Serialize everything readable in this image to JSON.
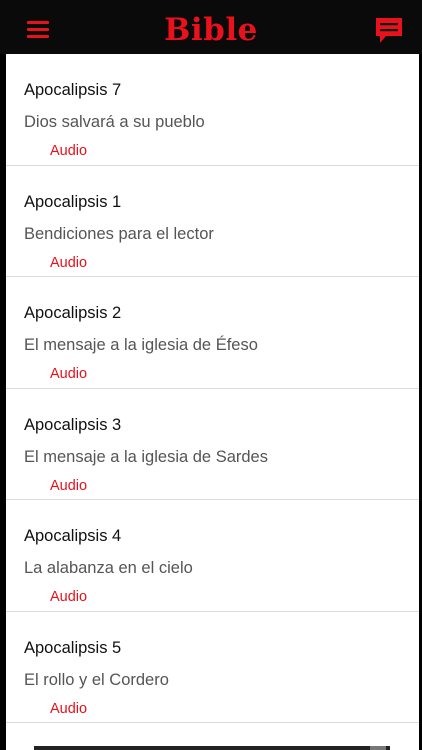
{
  "header": {
    "title": "Bible",
    "menu_icon": "hamburger-menu-icon",
    "chat_icon": "chat-bubble-icon",
    "accent_color": "#e8111c"
  },
  "items": [
    {
      "title": "Apocalipsis 7",
      "subtitle": "Dios salvará a su pueblo",
      "audio_label": "Audio"
    },
    {
      "title": "Apocalipsis 1",
      "subtitle": "Bendiciones para el lector",
      "audio_label": "Audio"
    },
    {
      "title": "Apocalipsis 2",
      "subtitle": "El mensaje a la iglesia de Éfeso",
      "audio_label": "Audio"
    },
    {
      "title": "Apocalipsis 3",
      "subtitle": "El mensaje a la iglesia de Sardes",
      "audio_label": "Audio"
    },
    {
      "title": "Apocalipsis 4",
      "subtitle": "La alabanza en el cielo",
      "audio_label": "Audio"
    },
    {
      "title": "Apocalipsis 5",
      "subtitle": "El rollo y el Cordero",
      "audio_label": "Audio"
    }
  ]
}
